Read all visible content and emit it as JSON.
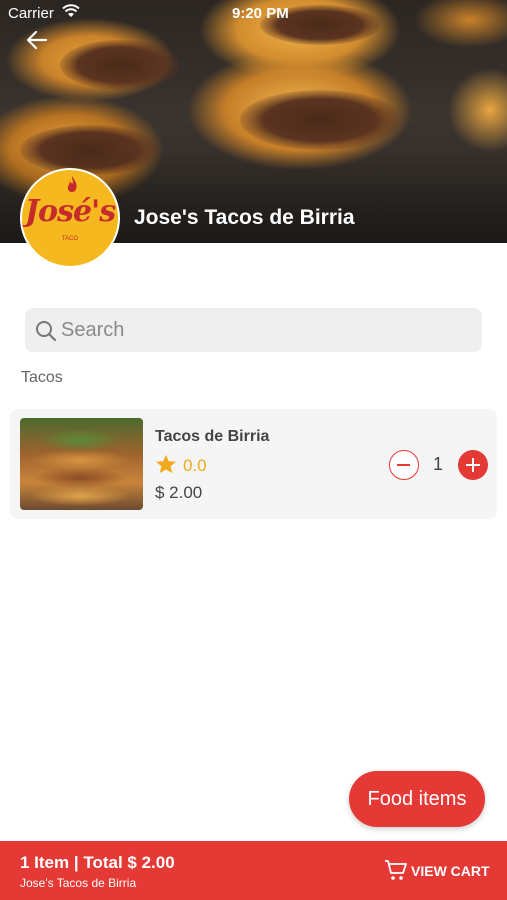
{
  "status_bar": {
    "carrier": "Carrier",
    "time": "9:20 PM"
  },
  "header": {
    "restaurant_name": "Jose's Tacos de Birria"
  },
  "logo": {
    "text": "José's",
    "subtext": "TACO"
  },
  "search": {
    "placeholder": "Search"
  },
  "category": {
    "label": "Tacos"
  },
  "items": [
    {
      "name": "Tacos de Birria",
      "rating": "0.0",
      "price": "$ 2.00",
      "quantity": "1"
    }
  ],
  "floating_button": {
    "label": "Food items"
  },
  "cart_bar": {
    "summary": "1 Item | Total $ 2.00",
    "restaurant": "Jose's Tacos de Birria",
    "view_cart_label": "VIEW CART"
  },
  "colors": {
    "accent": "#e53935",
    "star": "#f0a81c",
    "logo_bg": "#f5b81f"
  },
  "icons": [
    "wifi-icon",
    "back-arrow-icon",
    "search-icon",
    "star-icon",
    "minus-icon",
    "plus-icon",
    "cart-icon"
  ]
}
